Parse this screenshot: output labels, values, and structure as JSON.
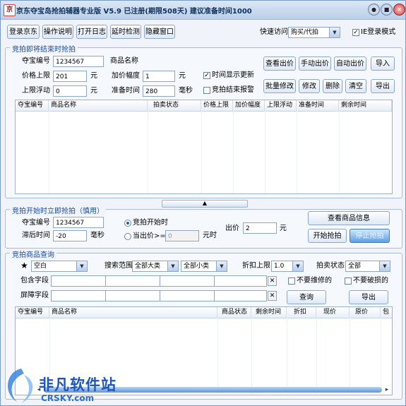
{
  "window": {
    "title": "京东夺宝岛抢拍辅器专业版 V5.9 已注册(期限508天) 建议准备时间1000",
    "app_icon_text": "京",
    "buttons": {
      "minimize": "●",
      "restore": "■",
      "close": "✕"
    }
  },
  "toolbar": {
    "login": "登录京东",
    "help": "操作说明",
    "log": "打开日志",
    "delay": "延时检测",
    "hide": "隐藏窗口",
    "quick_access_label": "快速访问",
    "quick_access_value": "购买/代拍",
    "ie_mode_label": "IE登录模式",
    "ie_mode_checked": "✓"
  },
  "ending": {
    "section_title": "竞拍即将结束时抢拍",
    "id_label": "夺宝编号",
    "id_value": "1234567",
    "product_name_label": "商品名称",
    "price_cap_label": "价格上限",
    "price_cap_value": "201",
    "yuan1": "元",
    "increment_label": "加价幅度",
    "increment_value": "1",
    "yuan2": "元",
    "float_label": "上限浮动",
    "float_value": "0",
    "yuan3": "元",
    "prep_time_label": "准备时间",
    "prep_time_value": "280",
    "ms": "毫秒",
    "show_time_label": "时间显示更新",
    "show_time_checked": "✓",
    "end_alert_label": "竞拍结束报警",
    "buttons": {
      "view_bid": "查看出价",
      "manual_bid": "手动出价",
      "auto_bid": "自动出价",
      "import": "导入",
      "batch_edit": "批量修改",
      "edit": "修改",
      "delete": "删除",
      "clear": "清空",
      "export": "导出"
    },
    "table": {
      "columns": [
        "夺宝编号",
        "商品名称",
        "拍卖状态",
        "价格上限",
        "加价幅度",
        "上限浮动",
        "准备时间",
        "剩余时间"
      ]
    }
  },
  "start": {
    "section_title": "竞拍开始时立即抢拍（慎用）",
    "id_label": "夺宝编号",
    "id_value": "1234567",
    "delay_label": "滞后时间",
    "delay_value": "-20",
    "ms": "毫秒",
    "radio_start": "竞拍开始时",
    "radio_price": "当出价>=",
    "price_value": "0",
    "yuan_time": "元时",
    "bid_label": "出价",
    "bid_value": "2",
    "yuan": "元",
    "view_product": "查看商品信息",
    "start_grab": "开始抢拍",
    "stop_grab": "停止抢拍"
  },
  "query": {
    "section_title": "竞拍商品查询",
    "star": "★",
    "blank_value": "空白",
    "search_range_label": "搜索范围",
    "category_value": "全部大类",
    "subcategory_value": "全部小类",
    "discount_label": "折扣上限",
    "discount_value": "1.0",
    "status_label": "拍卖状态",
    "status_value": "全部",
    "include_label": "包含字段",
    "exclude_label": "屏障字段",
    "clear_glyph": "✕",
    "no_repair_label": "不要维修的",
    "no_broken_label": "不要破损的",
    "query_btn": "查询",
    "export_btn": "导出",
    "table": {
      "columns": [
        "夺宝编号",
        "商品名称",
        "商品状态",
        "剩余时间",
        "折扣",
        "现价",
        "原价",
        "包"
      ]
    }
  },
  "splitter_glyph": "▲",
  "scroll": {
    "left": "◂",
    "right": "▸"
  },
  "watermark": {
    "text": "非凡软件站",
    "sub": "CRSKY.com"
  }
}
